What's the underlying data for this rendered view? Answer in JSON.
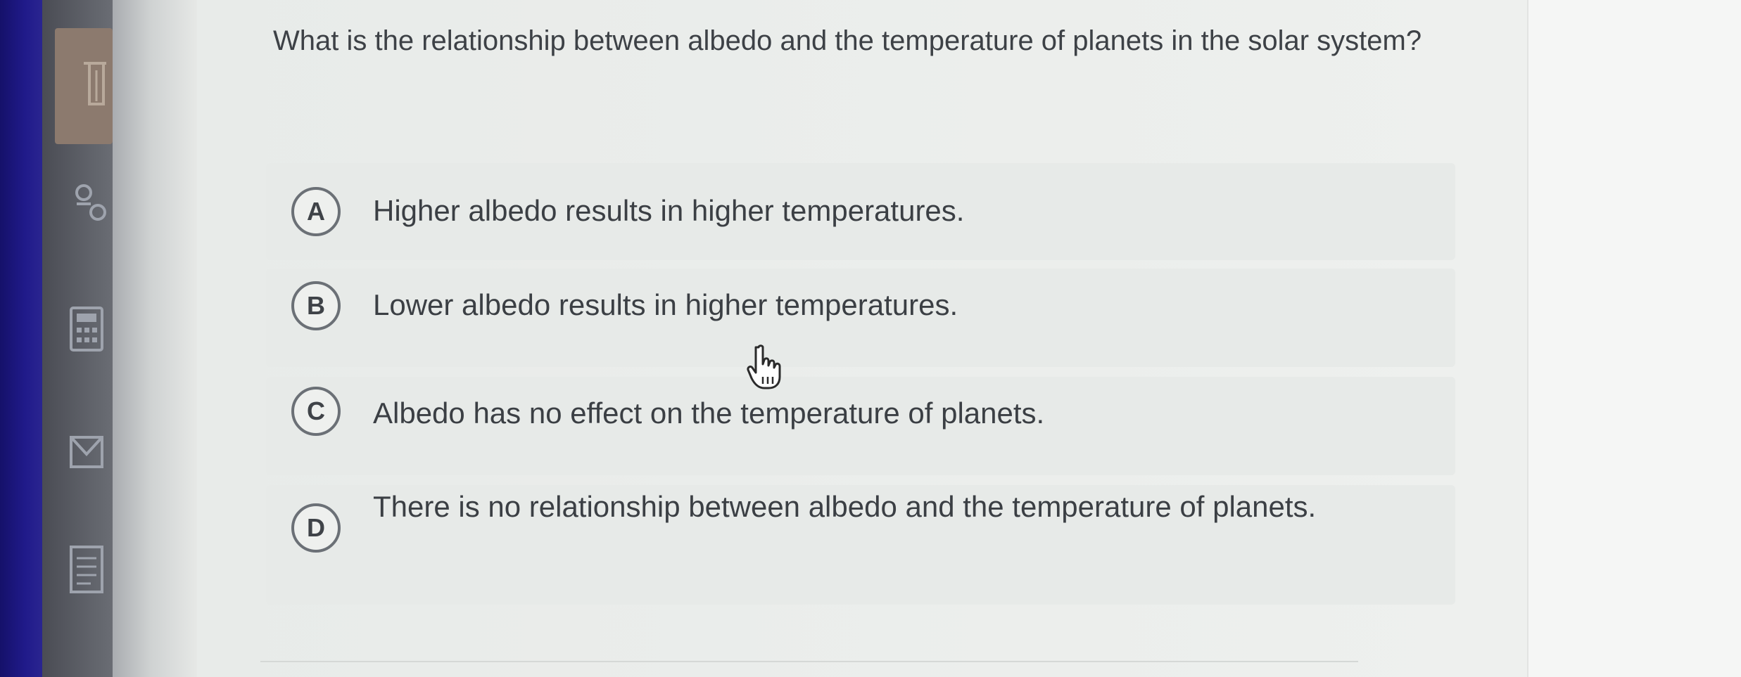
{
  "question": {
    "text": "What is the relationship between albedo and the temperature of planets in the solar system?"
  },
  "choices": [
    {
      "letter": "A",
      "text": "Higher albedo results in higher temperatures."
    },
    {
      "letter": "B",
      "text": "Lower albedo results in higher temperatures."
    },
    {
      "letter": "C",
      "text": "Albedo has no effect on the temperature of planets."
    },
    {
      "letter": "D",
      "text": "There is no relationship between albedo and the temperature of planets."
    }
  ],
  "icons": {
    "rail": [
      "reader-icon",
      "accessibility-icon",
      "calculator-icon",
      "flag-icon",
      "notepad-icon"
    ],
    "cursor": "hand-pointer-icon"
  },
  "colors": {
    "bezel": "#1b167a",
    "rail": "#5a5d64",
    "rail_active": "#8c7a6e",
    "panel": "#eceeec",
    "text": "#3d4146"
  }
}
